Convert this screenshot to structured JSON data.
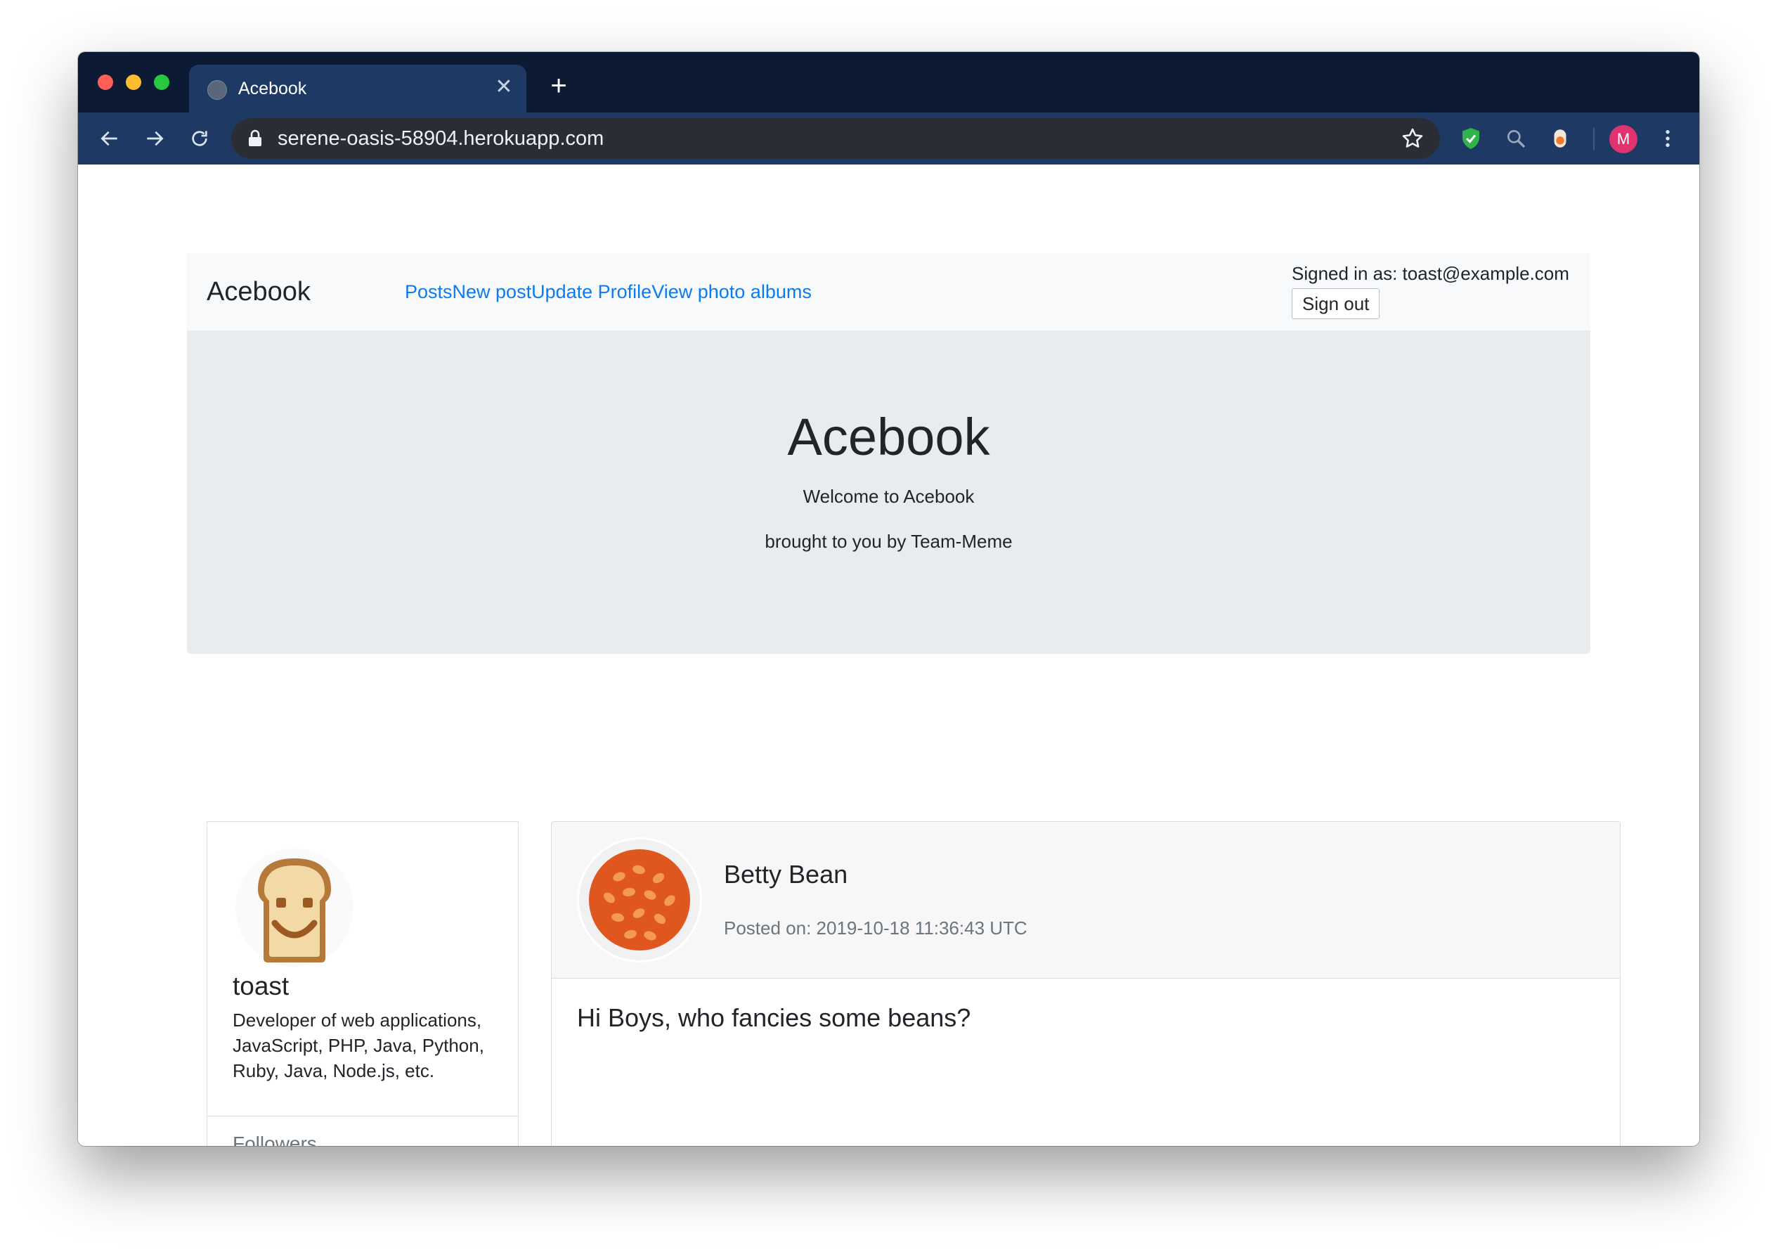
{
  "browser": {
    "tab_title": "Acebook",
    "tab_close": "✕",
    "new_tab": "+",
    "url": "serene-oasis-58904.herokuapp.com",
    "profile_initial": "M"
  },
  "navbar": {
    "brand": "Acebook",
    "links": [
      "Posts",
      "New post",
      "Update Profile",
      "View photo albums"
    ],
    "signed_in": "Signed in as: toast@example.com",
    "sign_out": "Sign out"
  },
  "jumbotron": {
    "heading": "Acebook",
    "welcome": "Welcome to Acebook",
    "byline": "brought to you by Team-Meme"
  },
  "profile": {
    "username": "toast",
    "bio": "Developer of web applications, JavaScript, PHP, Java, Python, Ruby, Java, Node.js, etc.",
    "followers_label": "Followers"
  },
  "post": {
    "author": "Betty Bean",
    "posted_on": "Posted on: 2019-10-18 11:36:43 UTC",
    "message": "Hi Boys, who fancies some beans?"
  },
  "colors": {
    "link": "#0d7bf0",
    "titlebar": "#0c1a33",
    "toolbar": "#1e3a64",
    "profile_avatar": "#e0336f"
  }
}
